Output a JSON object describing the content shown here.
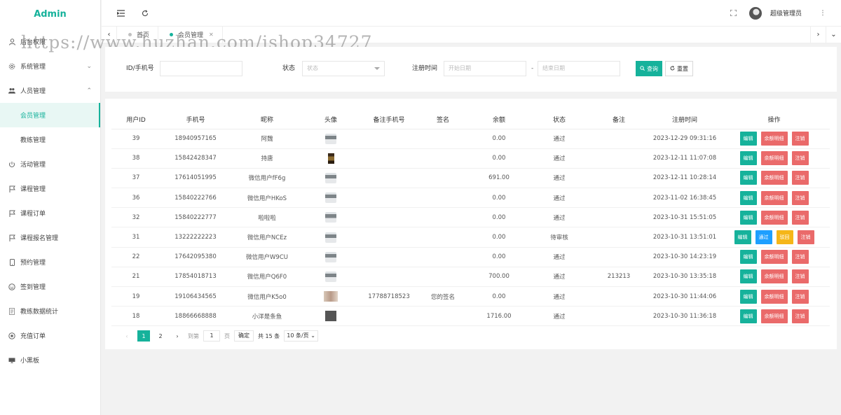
{
  "app": {
    "title": "Admin"
  },
  "sidebar": {
    "items": [
      {
        "label": "后台权限",
        "icon": "user-icon"
      },
      {
        "label": "系统管理",
        "icon": "gear-icon",
        "arrow": "⌄"
      },
      {
        "label": "人员管理",
        "icon": "users-icon",
        "arrow": "⌃"
      },
      {
        "label": "会员管理",
        "sub": true,
        "active": true
      },
      {
        "label": "教练管理",
        "sub": true
      },
      {
        "label": "活动管理",
        "icon": "activity-icon"
      },
      {
        "label": "课程管理",
        "icon": "flag-icon"
      },
      {
        "label": "课程订单",
        "icon": "flag-icon"
      },
      {
        "label": "课程报名管理",
        "icon": "flag-icon"
      },
      {
        "label": "预约管理",
        "icon": "phone-icon"
      },
      {
        "label": "签到管理",
        "icon": "smile-icon"
      },
      {
        "label": "教练数据统计",
        "icon": "doc-icon"
      },
      {
        "label": "充值订单",
        "icon": "record-icon"
      },
      {
        "label": "小黑板",
        "icon": "board-icon"
      }
    ]
  },
  "header": {
    "user_name": "超级管理员"
  },
  "tabs": [
    {
      "label": "首页",
      "active": false
    },
    {
      "label": "会员管理",
      "active": true
    }
  ],
  "search": {
    "id_label": "ID/手机号",
    "id_value": "",
    "status_label": "状态",
    "status_placeholder": "状态",
    "date_label": "注册时间",
    "start_placeholder": "开始日期",
    "end_placeholder": "结束日期",
    "date_sep": "-",
    "search_btn": "查询",
    "reset_btn": "重置"
  },
  "table": {
    "columns": [
      "用户ID",
      "手机号",
      "昵称",
      "头像",
      "备注手机号",
      "签名",
      "余额",
      "状态",
      "备注",
      "注册时间",
      "操作"
    ],
    "rows": [
      {
        "id": "39",
        "phone": "18940957165",
        "nick": "阿魏",
        "avatar": "horse",
        "note_phone": "",
        "sign": "",
        "balance": "0.00",
        "status": "通过",
        "note": "",
        "time": "2023-12-29 09:31:16",
        "ops": [
          "edit",
          "balance",
          "cancel"
        ]
      },
      {
        "id": "38",
        "phone": "15842428347",
        "nick": "持唐",
        "avatar": "phone",
        "note_phone": "",
        "sign": "",
        "balance": "0.00",
        "status": "通过",
        "note": "",
        "time": "2023-12-11 11:07:08",
        "ops": [
          "edit",
          "balance",
          "cancel"
        ]
      },
      {
        "id": "37",
        "phone": "17614051995",
        "nick": "微信用户fF6g",
        "avatar": "horse",
        "note_phone": "",
        "sign": "",
        "balance": "691.00",
        "status": "通过",
        "note": "",
        "time": "2023-12-11 10:28:14",
        "ops": [
          "edit",
          "balance",
          "cancel"
        ]
      },
      {
        "id": "36",
        "phone": "15840222766",
        "nick": "微信用户HKoS",
        "avatar": "horse",
        "note_phone": "",
        "sign": "",
        "balance": "0.00",
        "status": "通过",
        "note": "",
        "time": "2023-11-02 16:38:45",
        "ops": [
          "edit",
          "balance",
          "cancel"
        ]
      },
      {
        "id": "32",
        "phone": "15840222777",
        "nick": "啦啦啦",
        "avatar": "horse",
        "note_phone": "",
        "sign": "",
        "balance": "0.00",
        "status": "通过",
        "note": "",
        "time": "2023-10-31 15:51:05",
        "ops": [
          "edit",
          "balance",
          "cancel"
        ]
      },
      {
        "id": "31",
        "phone": "13222222223",
        "nick": "微信用户NCEz",
        "avatar": "horse",
        "note_phone": "",
        "sign": "",
        "balance": "0.00",
        "status": "待审核",
        "note": "",
        "time": "2023-10-31 13:51:01",
        "ops": [
          "edit",
          "approve",
          "reject",
          "cancel"
        ]
      },
      {
        "id": "22",
        "phone": "17642095380",
        "nick": "微信用户W9CU",
        "avatar": "horse",
        "note_phone": "",
        "sign": "",
        "balance": "0.00",
        "status": "通过",
        "note": "",
        "time": "2023-10-30 14:23:19",
        "ops": [
          "edit",
          "balance",
          "cancel"
        ]
      },
      {
        "id": "21",
        "phone": "17854018713",
        "nick": "微信用户Q6F0",
        "avatar": "horse",
        "note_phone": "",
        "sign": "",
        "balance": "700.00",
        "status": "通过",
        "note": "213213",
        "time": "2023-10-30 13:35:18",
        "ops": [
          "edit",
          "balance",
          "cancel"
        ]
      },
      {
        "id": "19",
        "phone": "19106434565",
        "nick": "微信用户K5o0",
        "avatar": "face",
        "note_phone": "17788718523",
        "sign": "您的签名",
        "balance": "0.00",
        "status": "通过",
        "note": "",
        "time": "2023-10-30 11:44:06",
        "ops": [
          "edit",
          "balance",
          "cancel"
        ]
      },
      {
        "id": "18",
        "phone": "18866668888",
        "nick": "小洋是条鱼",
        "avatar": "gray",
        "note_phone": "",
        "sign": "",
        "balance": "1716.00",
        "status": "通过",
        "note": "",
        "time": "2023-10-30 11:36:18",
        "ops": [
          "edit",
          "balance",
          "cancel"
        ]
      }
    ],
    "op_labels": {
      "edit": "编辑",
      "balance": "余额明细",
      "cancel": "注销",
      "approve": "通过",
      "reject": "驳回"
    }
  },
  "pager": {
    "pages": [
      "1",
      "2"
    ],
    "current": "1",
    "goto_label": "到第",
    "goto_value": "1",
    "page_unit": "页",
    "ok": "确定",
    "total": "共 15 条",
    "size": "10 条/页"
  },
  "watermark": "https://www.huzhan.com/ishop34727",
  "colors": {
    "accent": "#16b29b",
    "danger": "#ea6a6a",
    "info": "#1e9fff",
    "warn": "#f5b619"
  }
}
